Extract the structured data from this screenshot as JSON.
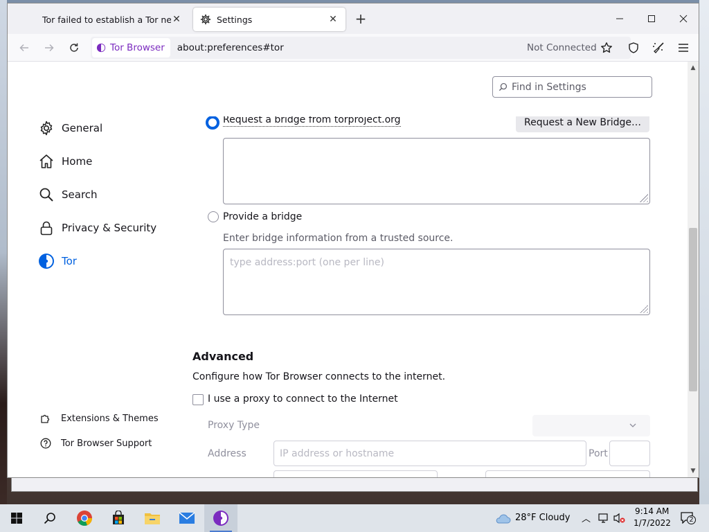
{
  "browser": {
    "tabs": [
      {
        "title": "Tor failed to establish a Tor network",
        "active": false
      },
      {
        "title": "Settings",
        "active": true
      }
    ],
    "identity_label": "Tor Browser",
    "url": "about:preferences#tor",
    "connection_status": "Not Connected"
  },
  "settings": {
    "search_placeholder": "Find in Settings",
    "categories": [
      {
        "label": "General",
        "icon": "gear-icon"
      },
      {
        "label": "Home",
        "icon": "home-icon"
      },
      {
        "label": "Search",
        "icon": "search-icon"
      },
      {
        "label": "Privacy & Security",
        "icon": "lock-icon"
      },
      {
        "label": "Tor",
        "icon": "tor-onion-icon",
        "selected": true
      }
    ],
    "footer_links": [
      {
        "label": "Extensions & Themes",
        "icon": "puzzle-icon"
      },
      {
        "label": "Tor Browser Support",
        "icon": "help-icon"
      }
    ],
    "bridges": {
      "request_label": "Request a bridge from torproject.org",
      "request_button": "Request a New Bridge…",
      "provide_label": "Provide a bridge",
      "provide_hint": "Enter bridge information from a trusted source.",
      "provide_placeholder": "type address:port (one per line)"
    },
    "advanced": {
      "heading": "Advanced",
      "description": "Configure how Tor Browser connects to the internet.",
      "proxy_checkbox": "I use a proxy to connect to the Internet",
      "proxy_type_label": "Proxy Type",
      "address_label": "Address",
      "address_placeholder": "IP address or hostname",
      "port_label": "Port"
    }
  },
  "taskbar": {
    "weather": "28°F  Cloudy",
    "time": "9:14 AM",
    "date": "1/7/2022",
    "notification_count": "2"
  },
  "colors": {
    "accent": "#0061e0",
    "tor_purple": "#7b2bbf"
  }
}
